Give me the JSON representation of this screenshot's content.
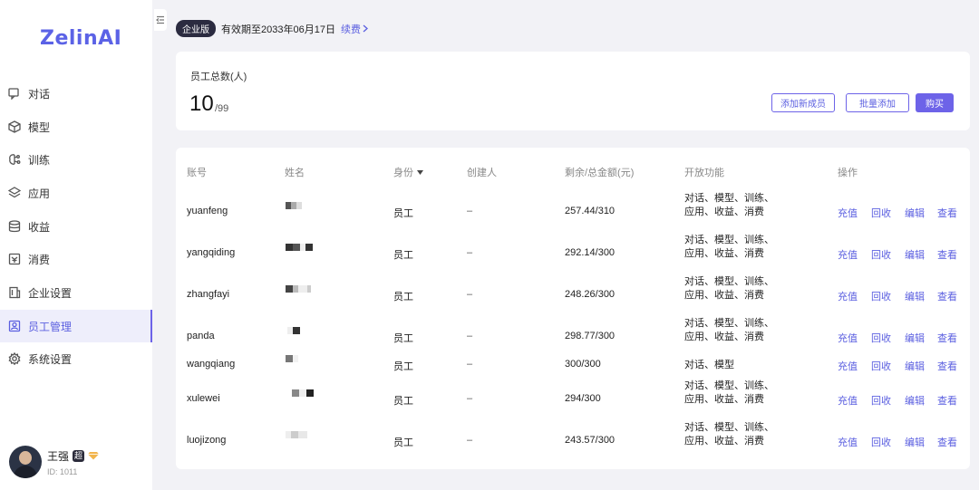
{
  "app": {
    "logo": "ZelinAI"
  },
  "nav": [
    {
      "label": "对话",
      "icon": "chat-icon"
    },
    {
      "label": "模型",
      "icon": "cube-icon"
    },
    {
      "label": "训练",
      "icon": "brain-icon"
    },
    {
      "label": "应用",
      "icon": "layers-icon"
    },
    {
      "label": "收益",
      "icon": "database-icon"
    },
    {
      "label": "消费",
      "icon": "receipt-icon"
    },
    {
      "label": "企业设置",
      "icon": "building-icon"
    },
    {
      "label": "员工管理",
      "icon": "user-card-icon",
      "active": true
    },
    {
      "label": "系统设置",
      "icon": "gear-icon"
    }
  ],
  "user": {
    "name": "王强",
    "badge": "超",
    "id_text": "ID: 1011"
  },
  "license": {
    "edition": "企业版",
    "expiry": "有效期至2033年06月17日",
    "renew": "续费"
  },
  "summary": {
    "label": "员工总数(人)",
    "count": "10",
    "max": "/99",
    "add_member": "添加新成员",
    "bulk_add": "批量添加",
    "buy": "购买"
  },
  "table": {
    "headers": {
      "account": "账号",
      "name": "姓名",
      "role": "身份",
      "creator": "创建人",
      "balance": "剩余/总金额(元)",
      "functions": "开放功能",
      "actions": "操作"
    },
    "actions": {
      "recharge": "充值",
      "reclaim": "回收",
      "edit": "编辑",
      "view": "查看"
    },
    "rows": [
      {
        "account": "yuanfeng",
        "role": "员工",
        "creator": "–",
        "balance": "257.44/310",
        "func1": "对话、模型、训练、",
        "func2": "应用、收益、消费"
      },
      {
        "account": "yangqiding",
        "role": "员工",
        "creator": "–",
        "balance": "292.14/300",
        "func1": "对话、模型、训练、",
        "func2": "应用、收益、消费"
      },
      {
        "account": "zhangfayi",
        "role": "员工",
        "creator": "–",
        "balance": "248.26/300",
        "func1": "对话、模型、训练、",
        "func2": "应用、收益、消费"
      },
      {
        "account": "panda",
        "role": "员工",
        "creator": "–",
        "balance": "298.77/300",
        "func1": "对话、模型、训练、",
        "func2": "应用、收益、消费"
      },
      {
        "account": "wangqiang",
        "role": "员工",
        "creator": "–",
        "balance": "300/300",
        "func1": "对话、模型",
        "func2": ""
      },
      {
        "account": "xulewei",
        "role": "员工",
        "creator": "–",
        "balance": "294/300",
        "func1": "对话、模型、训练、",
        "func2": "应用、收益、消费"
      },
      {
        "account": "luojizong",
        "role": "员工",
        "creator": "–",
        "balance": "243.57/300",
        "func1": "对话、模型、训练、",
        "func2": "应用、收益、消费"
      }
    ]
  }
}
